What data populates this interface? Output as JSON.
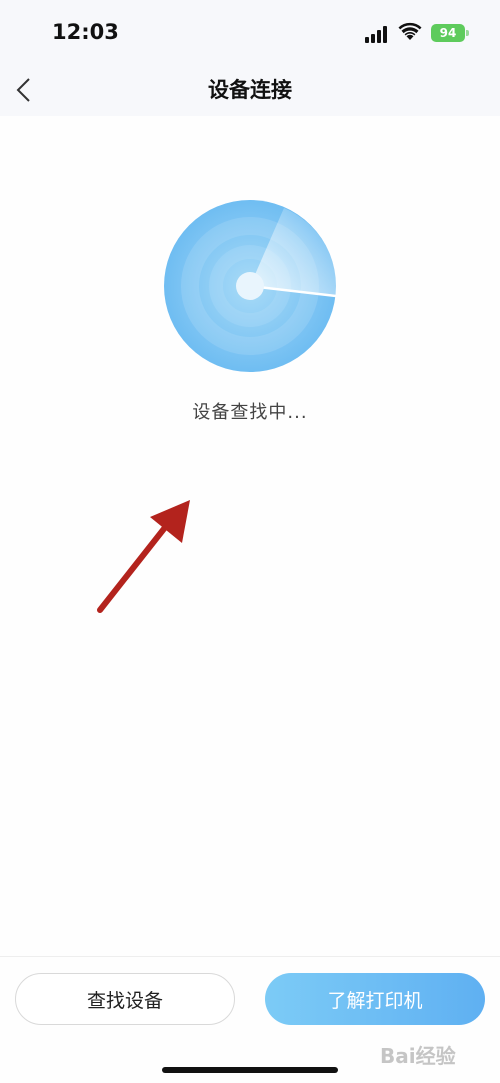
{
  "status_bar": {
    "time": "12:03",
    "battery": "94"
  },
  "nav": {
    "title": "设备连接"
  },
  "main": {
    "status_text": "设备查找中..."
  },
  "buttons": {
    "find_device": "查找设备",
    "learn_printer": "了解打印机"
  },
  "watermark": {
    "text": "Bai经验"
  },
  "colors": {
    "accent_start": "#7ccbf6",
    "accent_end": "#5fb0f2",
    "battery": "#5ecb5c",
    "annotation_arrow": "#b3231d"
  }
}
